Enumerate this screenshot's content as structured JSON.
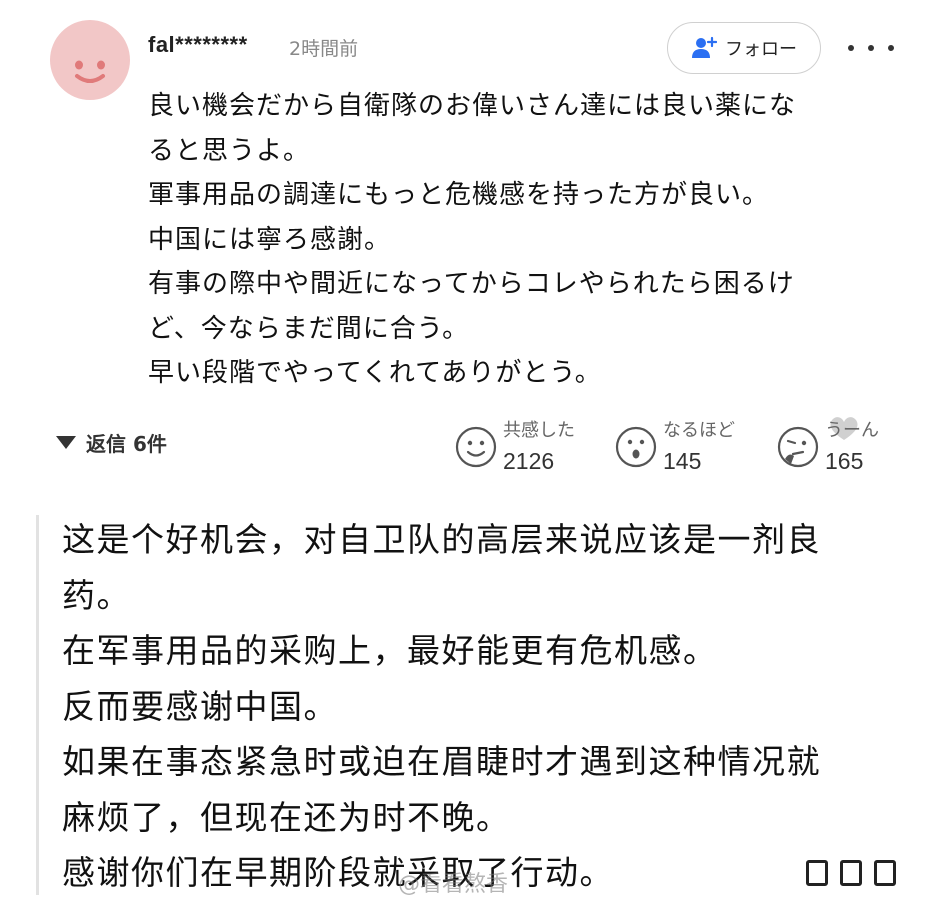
{
  "colors": {
    "avatar_bg": "#f2c7c7",
    "avatar_face": "#e07a7a",
    "text": "#111111",
    "muted": "#888888",
    "follow_icon": "#2b6ff2"
  },
  "comment": {
    "username": "fal********",
    "time": "2時間前",
    "follow_label": "フォロー",
    "body_jp": [
      "良い機会だから自衛隊のお偉いさん達には良い薬にな",
      "ると思うよ。",
      "軍事用品の調達にもっと危機感を持った方が良い。",
      "中国には寧ろ感謝。",
      "有事の際中や間近になってからコレやられたら困るけ",
      "ど、今ならまだ間に合う。",
      "早い段階でやってくれてありがとう。"
    ],
    "replies_label": "返信 6件"
  },
  "reactions": [
    {
      "icon": "smile-face-icon",
      "label": "共感した",
      "count": "2126"
    },
    {
      "icon": "surprised-face-icon",
      "label": "なるほど",
      "count": "145"
    },
    {
      "icon": "thinking-face-icon",
      "label": "うーん",
      "count": "165"
    }
  ],
  "translation_zh": [
    "这是个好机会，对自卫队的高层来说应该是一剂良",
    "药。",
    "在军事用品的采购上，最好能更有危机感。",
    "反而要感谢中国。",
    "如果在事态紧急时或迫在眉睫时才遇到这种情况就",
    "麻烦了，但现在还为时不晚。",
    "感谢你们在早期阶段就采取了行动。"
  ],
  "watermark": "@看看熬香"
}
